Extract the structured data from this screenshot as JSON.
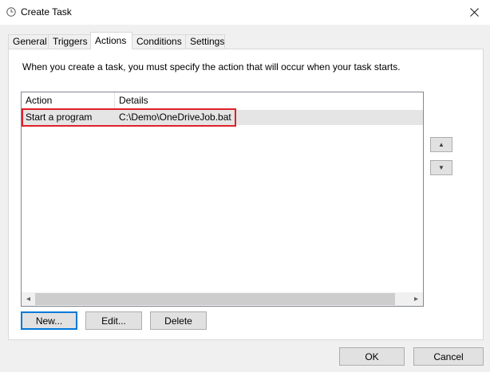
{
  "window": {
    "title": "Create Task",
    "icon": "clock-icon",
    "close_icon": "close-icon"
  },
  "tabs": [
    {
      "label": "General",
      "active": false
    },
    {
      "label": "Triggers",
      "active": false
    },
    {
      "label": "Actions",
      "active": true
    },
    {
      "label": "Conditions",
      "active": false
    },
    {
      "label": "Settings",
      "active": false
    }
  ],
  "actions_panel": {
    "description": "When you create a task, you must specify the action that will occur when your task starts.",
    "columns": [
      "Action",
      "Details"
    ],
    "rows": [
      {
        "action": "Start a program",
        "details": "C:\\Demo\\OneDriveJob.bat"
      }
    ],
    "highlight_color": "#e0202a",
    "move_up_icon": "triangle-up-icon",
    "move_down_icon": "triangle-down-icon",
    "buttons": {
      "new": "New...",
      "edit": "Edit...",
      "delete": "Delete"
    }
  },
  "footer": {
    "ok": "OK",
    "cancel": "Cancel"
  },
  "colors": {
    "accent": "#0078d7",
    "selection": "#e5e5e5"
  }
}
